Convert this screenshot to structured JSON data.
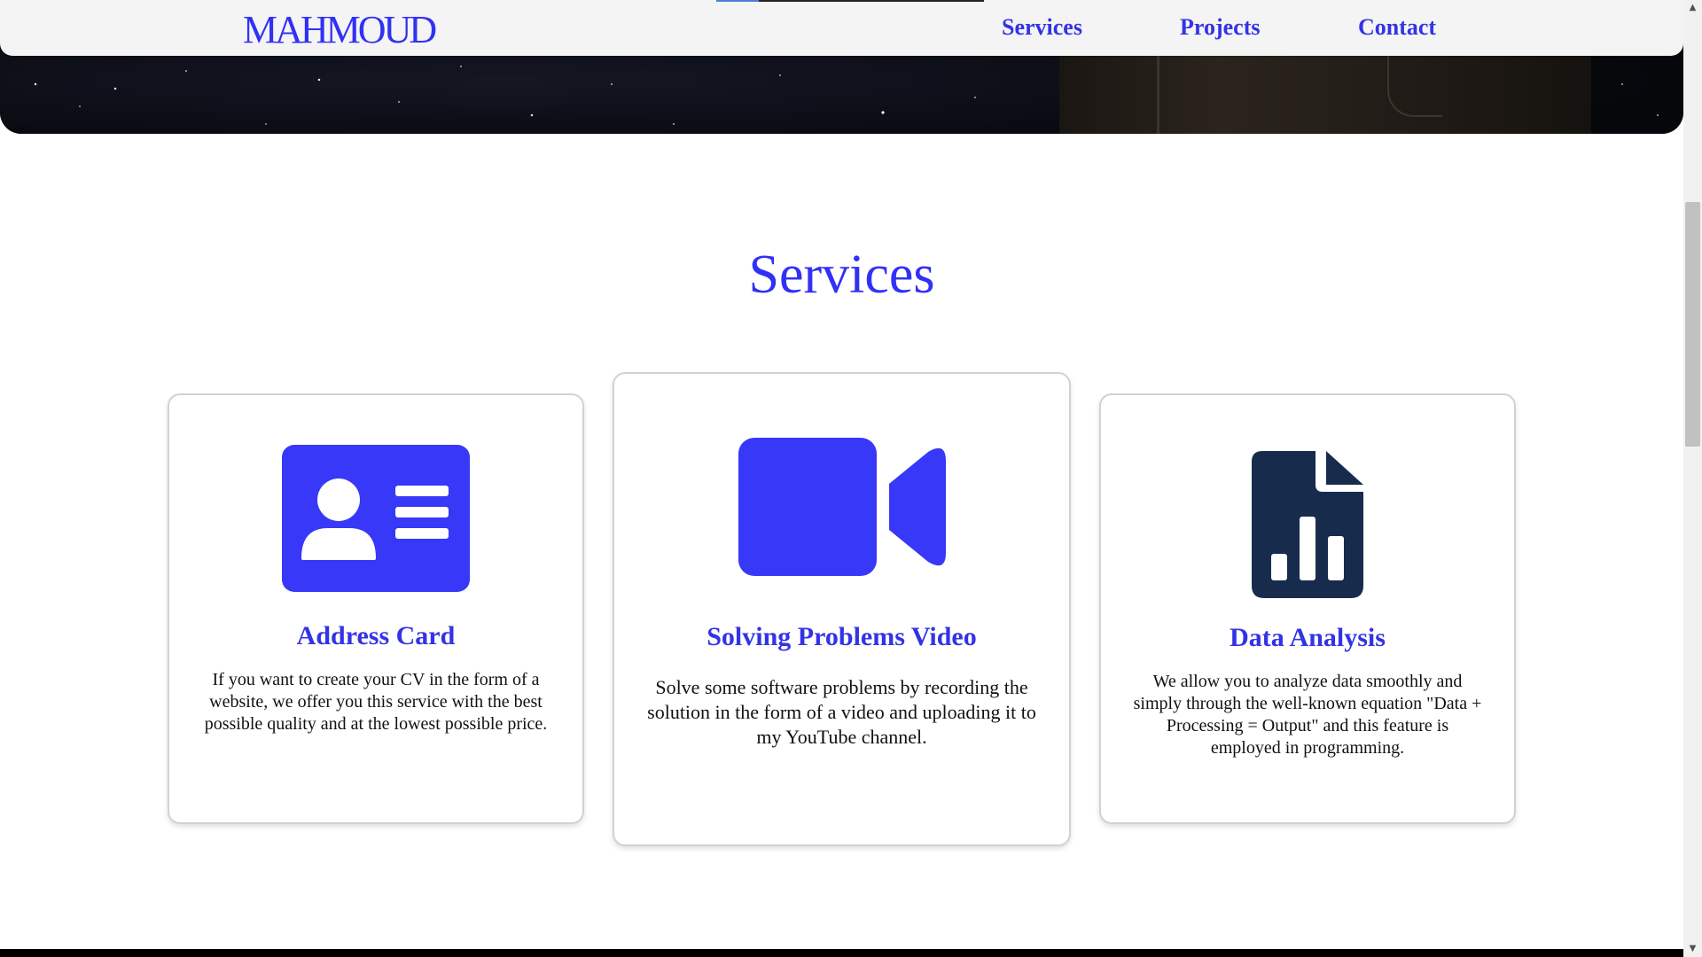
{
  "navbar": {
    "brand": "MAHMOUD",
    "links": [
      {
        "label": "Services"
      },
      {
        "label": "Projects"
      },
      {
        "label": "Contact"
      }
    ],
    "scroll_progress_percent": 16
  },
  "services": {
    "title": "Services",
    "cards": [
      {
        "icon": "address-card-icon",
        "title": "Address Card",
        "text": "If you want to create your CV in the form of a website, we offer you this service with the best possible quality and at the lowest possible price."
      },
      {
        "icon": "video-camera-icon",
        "title": "Solving Problems Video",
        "text": "Solve some software problems by recording the solution in the form of a video and uploading it to my YouTube channel."
      },
      {
        "icon": "file-chart-icon",
        "title": "Data Analysis",
        "text": "We allow you to analyze data smoothly and simply through the well-known equation \"Data + Processing = Output\" and this feature is employed in programming."
      }
    ]
  },
  "colors": {
    "accent": "#3131f5",
    "link": "#3333e6",
    "dark_icon": "#172b4d",
    "navbar_bg": "#f4f4f4"
  },
  "scrollbar": {
    "up_arrow": "▲",
    "down_arrow": "▼"
  }
}
